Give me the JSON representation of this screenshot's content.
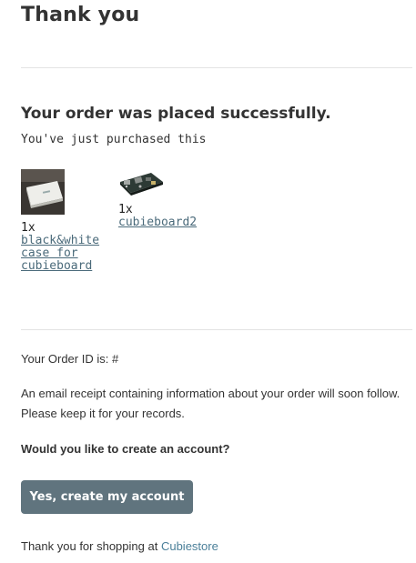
{
  "page": {
    "title": "Thank you",
    "success_heading": "Your order was placed successfully.",
    "purchase_note": "You've just purchased this"
  },
  "products": [
    {
      "quantity": "1x",
      "name": "black&white case for cubieboard",
      "image_icon": "white-case-photo"
    },
    {
      "quantity": "1x",
      "name": "cubieboard2",
      "image_icon": "circuit-board-photo"
    }
  ],
  "order": {
    "id_text": "Your Order ID is: #",
    "receipt_text": "An email receipt containing information about your order will soon follow. Please keep it for your records."
  },
  "account": {
    "question": "Would you like to create an account?",
    "button_label": "Yes, create my account"
  },
  "footer": {
    "thanks_prefix": "Thank you for shopping at",
    "store_name": "Cubiestore"
  },
  "colors": {
    "button_bg": "#60747e",
    "link": "#4a7f99",
    "product_name": "#4a6a7a"
  }
}
